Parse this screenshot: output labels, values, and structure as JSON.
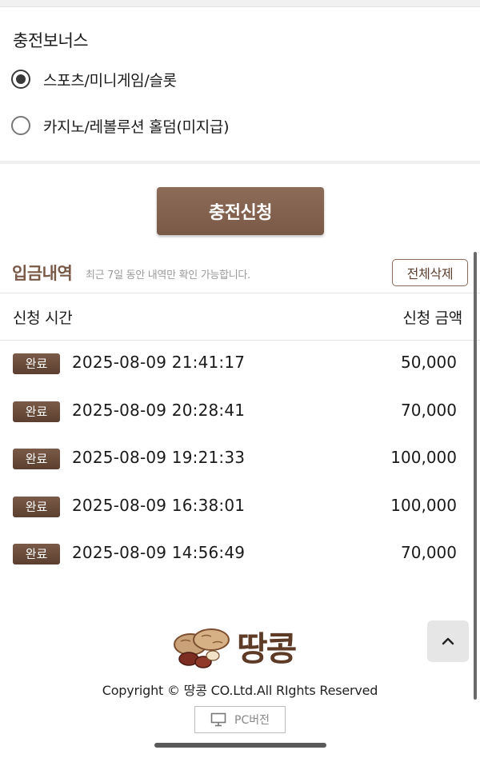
{
  "bonus": {
    "title": "충전보너스",
    "options": [
      {
        "label": "스포츠/미니게임/슬롯",
        "selected": true
      },
      {
        "label": "카지노/레볼루션 홀덤(미지급)",
        "selected": false
      }
    ]
  },
  "submit_label": "충전신청",
  "history": {
    "title": "입금내역",
    "note": "최근 7일 동안 내역만 확인 가능합니다.",
    "delete_all_label": "전체삭제",
    "columns": {
      "time": "신청 시간",
      "amount": "신청 금액"
    },
    "rows": [
      {
        "status": "완료",
        "time": "2025-08-09 21:41:17",
        "amount": "50,000"
      },
      {
        "status": "완료",
        "time": "2025-08-09 20:28:41",
        "amount": "70,000"
      },
      {
        "status": "완료",
        "time": "2025-08-09 19:21:33",
        "amount": "100,000"
      },
      {
        "status": "완료",
        "time": "2025-08-09 16:38:01",
        "amount": "100,000"
      },
      {
        "status": "완료",
        "time": "2025-08-09 14:56:49",
        "amount": "70,000"
      }
    ]
  },
  "footer": {
    "logo_text": "땅콩",
    "copyright": "Copyright © 땅콩 CO.Ltd.All RIghts Reserved",
    "pc_version_label": "PC버전"
  },
  "colors": {
    "brand_brown": "#7a5a47",
    "badge_brown": "#5c3f30",
    "logo_brown": "#5e3b26"
  },
  "icons": {
    "scroll_top": "chevron-up-icon",
    "pc": "monitor-icon",
    "logo": "peanut-icon"
  }
}
